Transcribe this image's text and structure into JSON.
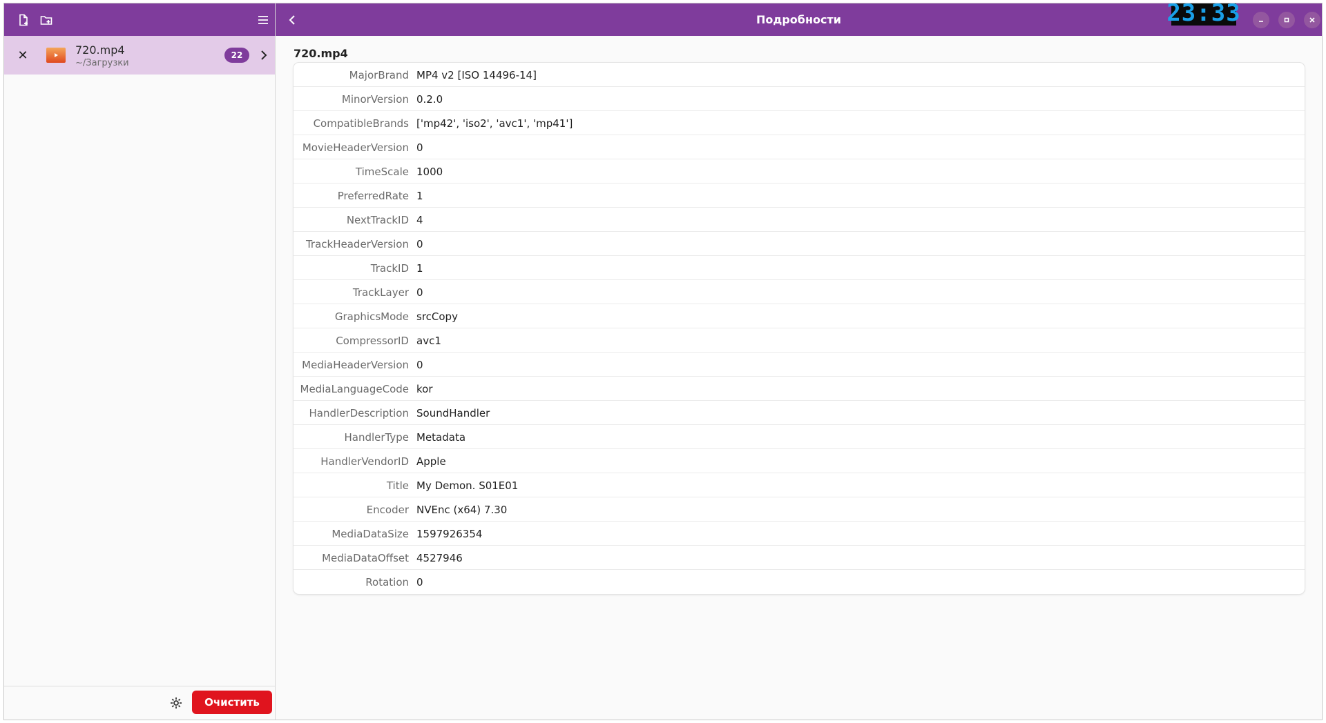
{
  "header": {
    "title": "Подробности",
    "clock": "23:33"
  },
  "sidebar": {
    "toolbar": {
      "add_file_icon": "file-plus-icon",
      "add_folder_icon": "folder-plus-icon",
      "menu_icon": "hamburger-menu-icon"
    },
    "files": [
      {
        "name": "720.mp4",
        "path": "~/Загрузки",
        "count": "22"
      }
    ],
    "footer": {
      "clear_label": "Очистить"
    }
  },
  "main": {
    "file_title": "720.mp4",
    "properties": [
      {
        "key": "MajorBrand",
        "value": "MP4 v2 [ISO 14496-14]"
      },
      {
        "key": "MinorVersion",
        "value": "0.2.0"
      },
      {
        "key": "CompatibleBrands",
        "value": "['mp42', 'iso2', 'avc1', 'mp41']"
      },
      {
        "key": "MovieHeaderVersion",
        "value": "0"
      },
      {
        "key": "TimeScale",
        "value": "1000"
      },
      {
        "key": "PreferredRate",
        "value": "1"
      },
      {
        "key": "NextTrackID",
        "value": "4"
      },
      {
        "key": "TrackHeaderVersion",
        "value": "0"
      },
      {
        "key": "TrackID",
        "value": "1"
      },
      {
        "key": "TrackLayer",
        "value": "0"
      },
      {
        "key": "GraphicsMode",
        "value": "srcCopy"
      },
      {
        "key": "CompressorID",
        "value": "avc1"
      },
      {
        "key": "MediaHeaderVersion",
        "value": "0"
      },
      {
        "key": "MediaLanguageCode",
        "value": "kor"
      },
      {
        "key": "HandlerDescription",
        "value": "SoundHandler"
      },
      {
        "key": "HandlerType",
        "value": "Metadata"
      },
      {
        "key": "HandlerVendorID",
        "value": "Apple"
      },
      {
        "key": "Title",
        "value": "My Demon. S01E01"
      },
      {
        "key": "Encoder",
        "value": "NVEnc (x64) 7.30"
      },
      {
        "key": "MediaDataSize",
        "value": "1597926354"
      },
      {
        "key": "MediaDataOffset",
        "value": "4527946"
      },
      {
        "key": "Rotation",
        "value": "0"
      }
    ]
  },
  "colors": {
    "accent": "#7f3c9c",
    "selected_row": "#e3cbe8",
    "danger": "#e0141e"
  }
}
